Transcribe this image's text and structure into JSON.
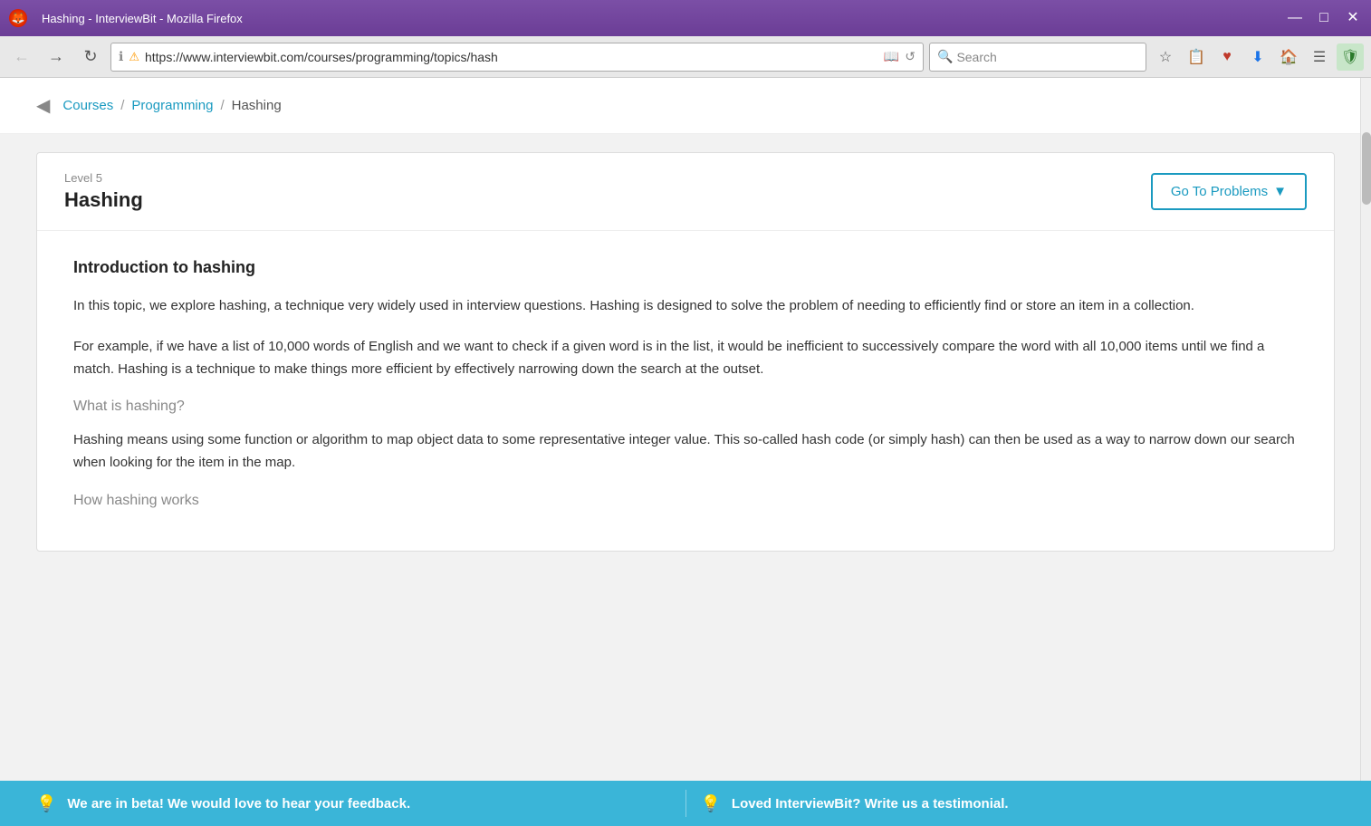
{
  "browser": {
    "title": "Hashing - InterviewBit - Mozilla Firefox",
    "url": "https://www.interviewbit.com/courses/programming/topics/hash",
    "search_placeholder": "Search",
    "minimize_btn": "—",
    "maximize_btn": "□",
    "close_btn": "✕"
  },
  "breadcrumb": {
    "back_icon": "◀",
    "courses_label": "Courses",
    "programming_label": "Programming",
    "current_label": "Hashing"
  },
  "card": {
    "level": "Level 5",
    "title": "Hashing",
    "goto_btn": "Go To Problems"
  },
  "content": {
    "intro_heading": "Introduction to hashing",
    "intro_para1": "In this topic, we explore hashing, a technique very widely used in interview questions. Hashing is designed to solve the problem of needing to efficiently find or store an item in a collection.",
    "intro_para2": "For example, if we have a list of 10,000 words of English and we want to check if a given word is in the list, it would be inefficient to successively compare the word with all 10,000 items until we find a match. Hashing is a technique to make things more efficient by effectively narrowing down the search at the outset.",
    "what_heading": "What is hashing?",
    "what_para": "Hashing means using some function or algorithm to map object data to some representative integer value. This so-called hash code (or simply hash) can then be used as a way to narrow down our search when looking for the item in the map.",
    "how_heading": "How hashing works"
  },
  "bottom_bar": {
    "left_icon": "💡",
    "left_text": "We are in beta! We would love to hear your feedback.",
    "right_icon": "💡",
    "right_text": "Loved InterviewBit? Write us a testimonial."
  }
}
